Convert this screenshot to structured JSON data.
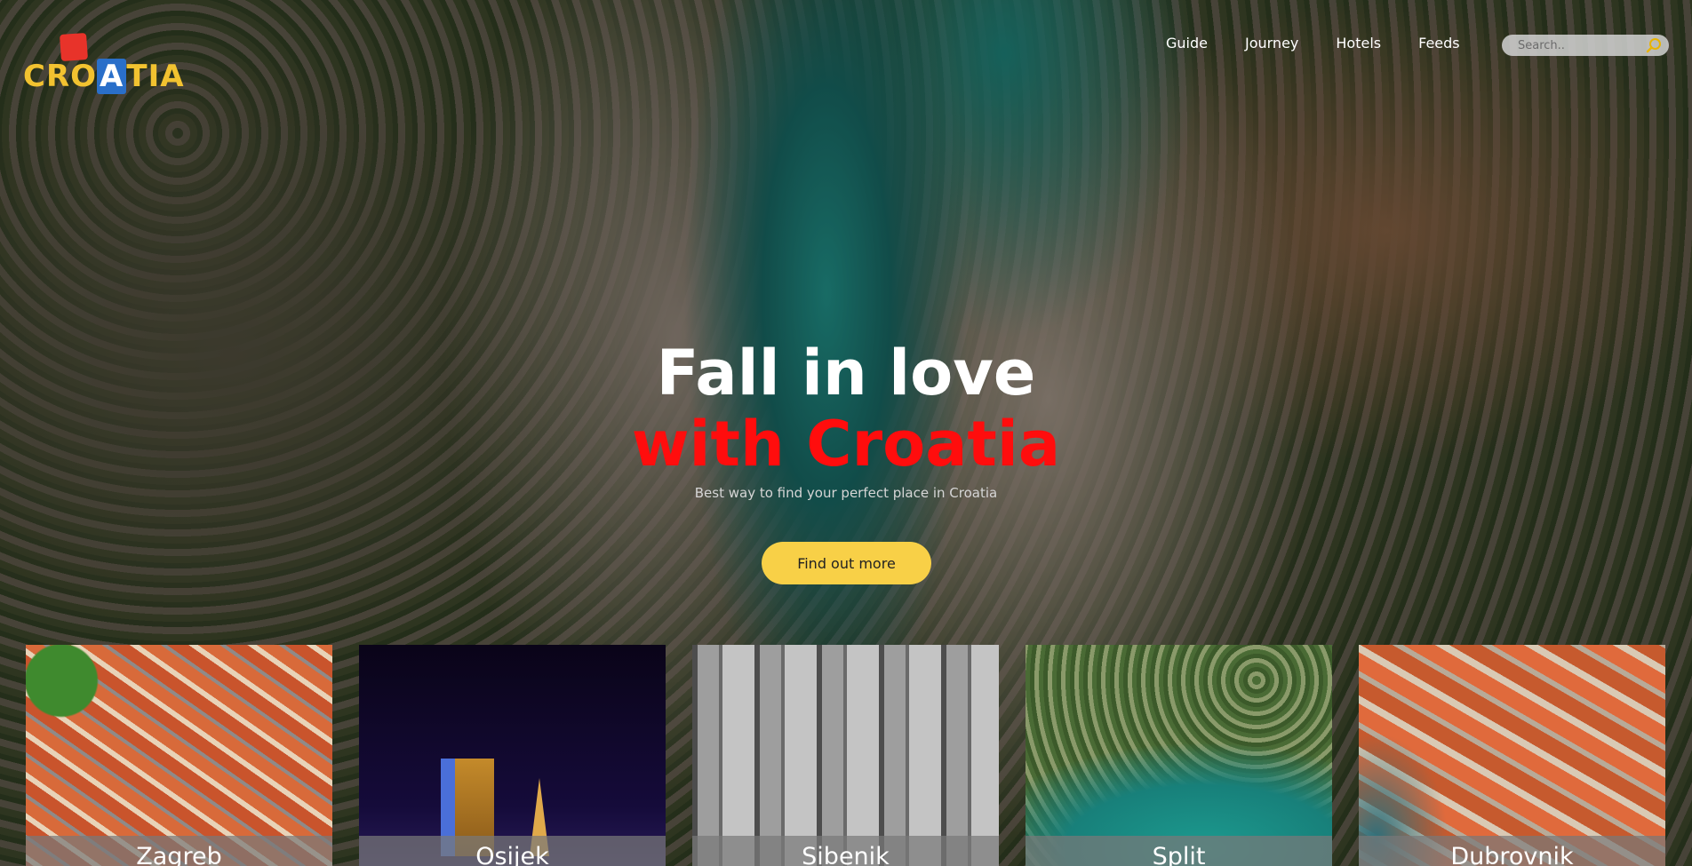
{
  "brand": {
    "logo_text": "CROATIA",
    "logo_colors": {
      "mark": "#e8332a",
      "letters": "#f2c230",
      "accent": "#2a6fc9"
    }
  },
  "nav": {
    "items": [
      {
        "label": "Guide"
      },
      {
        "label": "Journey"
      },
      {
        "label": "Hotels"
      },
      {
        "label": "Feeds"
      }
    ]
  },
  "search": {
    "placeholder": "Search.."
  },
  "hero": {
    "title_line1": "Fall in love",
    "title_line2": "with Croatia",
    "tagline": "Best way to find your perfect place in Croatia",
    "cta_label": "Find out more",
    "colors": {
      "title_line1": "#ffffff",
      "title_line2": "#ff0d0d",
      "cta": "#f8d047"
    }
  },
  "cities": [
    {
      "name": "Zagreb"
    },
    {
      "name": "Osijek"
    },
    {
      "name": "Sibenik"
    },
    {
      "name": "Split"
    },
    {
      "name": "Dubrovnik"
    }
  ]
}
